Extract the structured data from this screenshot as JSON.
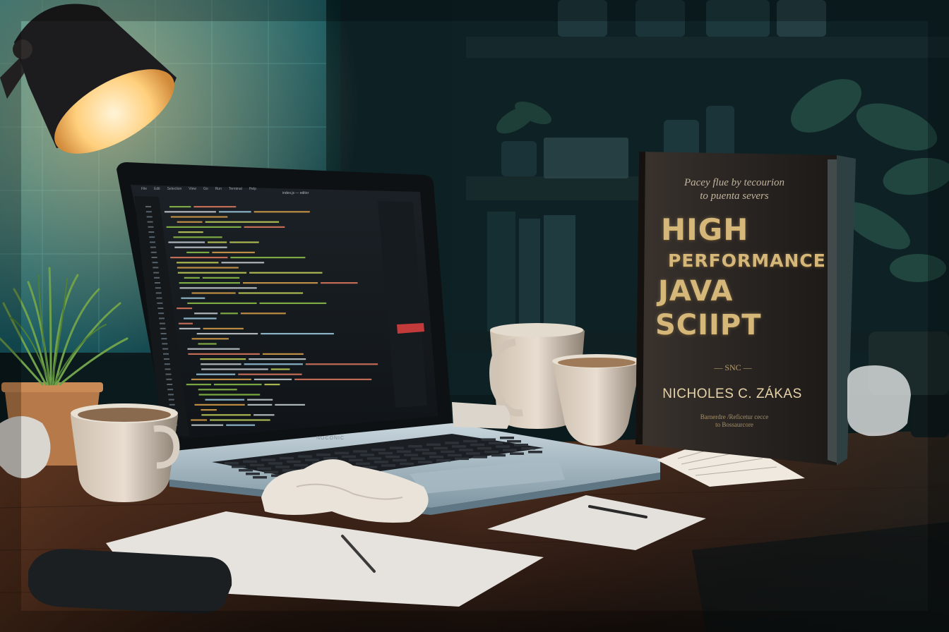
{
  "scene": {
    "description_colors": {
      "background": "#0a1618",
      "teal_glow": "#1f6f78",
      "lamp_light": "#ffd79a",
      "desk": "#3a2418",
      "book_cover": "#2a2522",
      "gold": "#d6b77a"
    }
  },
  "book": {
    "subtitle_line1": "Pacey flue by tecourion",
    "subtitle_line2": "to puenta severs",
    "title_line1": "HIGH",
    "title_line2": "PERFORMANCE",
    "title_line3": "JAVA",
    "title_line4": "SCIIPT",
    "mark": "— SNC —",
    "author": "NICHOLES C. ZÁKAS",
    "tagline_line1": "Barnerdre /Reficetur cecce",
    "tagline_line2": "to Bossaurcore"
  },
  "laptop": {
    "brand": "NOCONIC",
    "menu": [
      "File",
      "Edit",
      "Selection",
      "View",
      "Go",
      "Run",
      "Terminal",
      "Help"
    ],
    "window_title": "index.js — editor"
  }
}
